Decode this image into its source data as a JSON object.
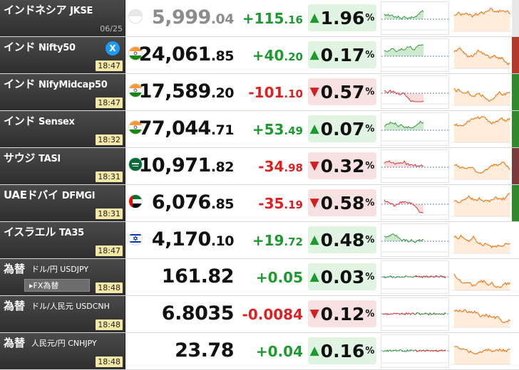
{
  "colors": {
    "up": "#1d9a2f",
    "down": "#e02020",
    "up_bg": "#e1f3e1",
    "down_bg": "#f8e1e1",
    "time_bg": "#f3e7a6"
  },
  "x_button_label": "X",
  "rows": [
    {
      "country": "インドネシア",
      "index": "JKSE",
      "time": "06/25",
      "flag_icon": "indonesia-flag-icon",
      "price_int": "5,999",
      "price_dec": ".04",
      "change_int": "+115",
      "change_dec": ".16",
      "pct": "1.96",
      "dir": "up",
      "side_color": "#e8e8e8"
    },
    {
      "country": "インド",
      "index": "Nifty50",
      "time": "18:47",
      "flag_icon": "india-flag-icon",
      "price_int": "24,061",
      "price_dec": ".85",
      "change_int": "+40",
      "change_dec": ".20",
      "pct": "0.17",
      "dir": "up",
      "side_color": "#b23a2a"
    },
    {
      "country": "インド",
      "index": "NifyMidcap50",
      "time": "18:47",
      "flag_icon": "india-flag-icon",
      "price_int": "17,589",
      "price_dec": ".20",
      "change_int": "-101",
      "change_dec": ".10",
      "pct": "0.57",
      "dir": "down",
      "side_color": "#2d8a2d"
    },
    {
      "country": "インド",
      "index": "Sensex",
      "time": "18:32",
      "flag_icon": "india-flag-icon",
      "price_int": "77,044",
      "price_dec": ".71",
      "change_int": "+53",
      "change_dec": ".49",
      "pct": "0.07",
      "dir": "up",
      "side_color": "#2d8a2d"
    },
    {
      "country": "サウジ",
      "index": "TASI",
      "time": "18:31",
      "flag_icon": "saudi-flag-icon",
      "price_int": "10,971",
      "price_dec": ".82",
      "change_int": "-34",
      "change_dec": ".98",
      "pct": "0.32",
      "dir": "down",
      "side_color": "#7a3a3a"
    },
    {
      "country": "UAEドバイ",
      "index": "DFMGI",
      "time": "18:31",
      "flag_icon": "uae-flag-icon",
      "price_int": "6,076",
      "price_dec": ".85",
      "change_int": "-35",
      "change_dec": ".19",
      "pct": "0.58",
      "dir": "down",
      "side_color": "#2d8a2d"
    },
    {
      "country": "イスラエル",
      "index": "TA35",
      "time": "18:47",
      "flag_icon": "israel-flag-icon",
      "price_int": "4,170",
      "price_dec": ".10",
      "change_int": "+19",
      "change_dec": ".72",
      "pct": "0.48",
      "dir": "up",
      "side_color": "#ffffff"
    },
    {
      "fx": true,
      "tag": "為替",
      "pair": "ドル/円 USDJPY",
      "time": "18:48",
      "button": "FX為替",
      "price_int": "161.82",
      "price_dec": "",
      "change_int": "+0.05",
      "change_dec": "",
      "pct": "0.03",
      "dir": "up",
      "side_color": "#ffffff"
    },
    {
      "fx": true,
      "tag": "為替",
      "pair": "ドル/人民元 USDCNH",
      "time": "18:48",
      "price_int": "6.8035",
      "price_dec": "",
      "change_int": "-0.0084",
      "change_dec": "",
      "pct": "0.12",
      "dir": "down",
      "side_color": "#ffffff"
    },
    {
      "fx": true,
      "tag": "為替",
      "pair": "人民元/円 CNHJPY",
      "time": "18:48",
      "price_int": "23.78",
      "price_dec": "",
      "change_int": "+0.04",
      "change_dec": "",
      "pct": "0.16",
      "dir": "up",
      "side_color": "#ffffff"
    }
  ]
}
